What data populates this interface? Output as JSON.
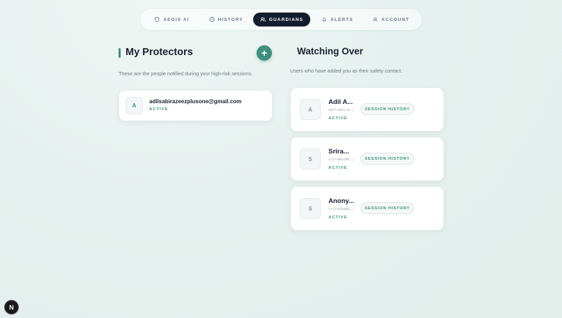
{
  "nav": {
    "items": [
      {
        "label": "AEGIS AI",
        "icon": "shield-icon"
      },
      {
        "label": "HISTORY",
        "icon": "clock-icon"
      },
      {
        "label": "GUARDIANS",
        "icon": "users-icon",
        "active": true
      },
      {
        "label": "ALERTS",
        "icon": "bell-icon"
      },
      {
        "label": "ACCOUNT",
        "icon": "user-icon"
      }
    ]
  },
  "protectors": {
    "title": "My Protectors",
    "add_label": "+",
    "subtitle": "These are the people notified during your high-risk sessions.",
    "items": [
      {
        "initial": "A",
        "email": "adilsabirazeezplusone@gmail.com",
        "status": "ACTIVE"
      }
    ]
  },
  "watching": {
    "title": "Watching Over",
    "subtitle": "Users who have added you as their safety contact.",
    "button_label": "SESSION HISTORY",
    "items": [
      {
        "initial": "A",
        "name": "Adil A...",
        "email": "adilsabira...",
        "status": "ACTIVE"
      },
      {
        "initial": "S",
        "name": "Srira...",
        "email": "sriramu248...",
        "status": "ACTIVE"
      },
      {
        "initial": "S",
        "name": "Anony...",
        "email": "srijonkuma...",
        "status": "ACTIVE"
      }
    ]
  },
  "corner_badge": "N",
  "colors": {
    "accent": "#3d8f7c",
    "nav_active": "#141d2e"
  }
}
